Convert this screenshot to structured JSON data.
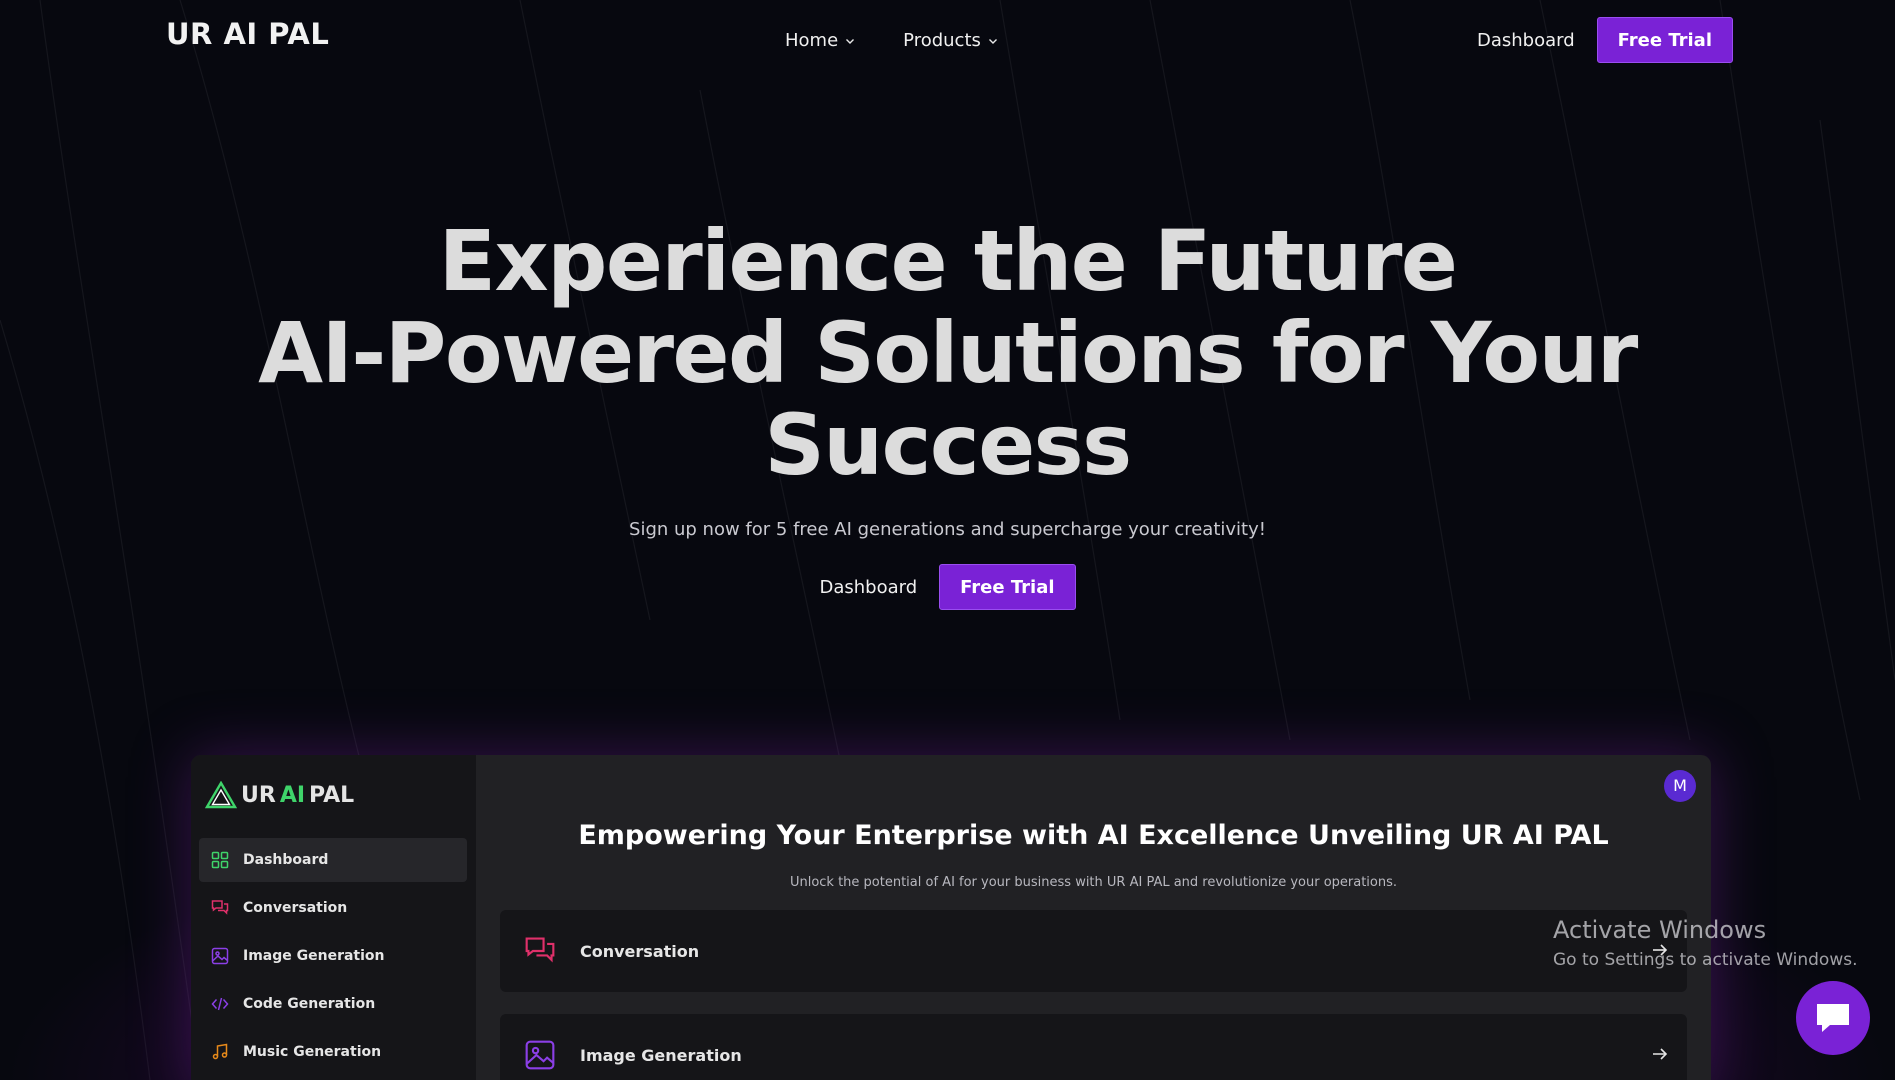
{
  "nav": {
    "logo": "UR AI PAL",
    "menu": [
      {
        "label": "Home"
      },
      {
        "label": "Products"
      }
    ],
    "dashboard_label": "Dashboard",
    "free_trial_label": "Free Trial"
  },
  "hero": {
    "title_line1": "Experience the Future",
    "title_line2": "AI-Powered Solutions for Your",
    "title_line3": "Success",
    "subtitle": "Sign up now for 5 free AI generations and supercharge your creativity!",
    "dashboard_label": "Dashboard",
    "free_trial_label": "Free Trial"
  },
  "preview": {
    "logo_ur": "UR",
    "logo_ai": "AI",
    "logo_pal": "PAL",
    "sidebar": [
      {
        "label": "Dashboard",
        "icon": "grid-icon",
        "color": "#3fd46a"
      },
      {
        "label": "Conversation",
        "icon": "chat-bubbles-icon",
        "color": "#e0306a"
      },
      {
        "label": "Image Generation",
        "icon": "image-icon",
        "color": "#8b3fe6"
      },
      {
        "label": "Code Generation",
        "icon": "code-icon",
        "color": "#8b3fe6"
      },
      {
        "label": "Music Generation",
        "icon": "music-icon",
        "color": "#e88a1a"
      }
    ],
    "avatar_initial": "M",
    "title": "Empowering Your Enterprise with AI Excellence Unveiling UR AI PAL",
    "subtitle": "Unlock the potential of AI for your business with UR AI PAL and revolutionize your operations.",
    "cards": [
      {
        "label": "Conversation",
        "icon": "chat-bubbles-icon",
        "color": "#e0306a"
      },
      {
        "label": "Image Generation",
        "icon": "image-icon",
        "color": "#8b3fe6"
      }
    ]
  },
  "watermark": {
    "title": "Activate Windows",
    "subtitle": "Go to Settings to activate Windows."
  },
  "colors": {
    "background": "#07080f",
    "accent": "#7a22d6"
  }
}
